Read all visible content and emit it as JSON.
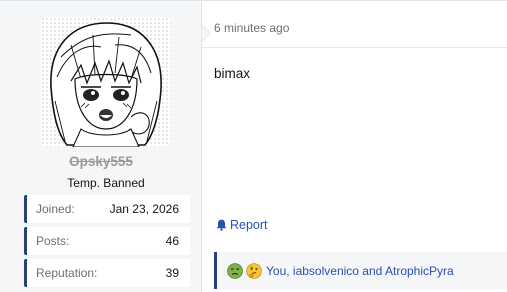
{
  "user": {
    "username": "Opsky555",
    "title": "Temp. Banned",
    "stats": [
      {
        "label": "Joined:",
        "value": "Jan 23, 2026"
      },
      {
        "label": "Posts:",
        "value": "46"
      },
      {
        "label": "Reputation:",
        "value": "39"
      }
    ]
  },
  "post": {
    "timestamp": "6 minutes ago",
    "message": "bimax",
    "report_label": "Report",
    "reactions": {
      "emojis": [
        "sick-face-icon",
        "thinking-face-icon"
      ],
      "users_text": "You, iabsolvenico and AtrophicPyra"
    }
  },
  "colors": {
    "accent": "#2a3f7a",
    "link": "#2a4fb0",
    "panel": "#f5f6f8",
    "muted": "#6a6f76"
  }
}
